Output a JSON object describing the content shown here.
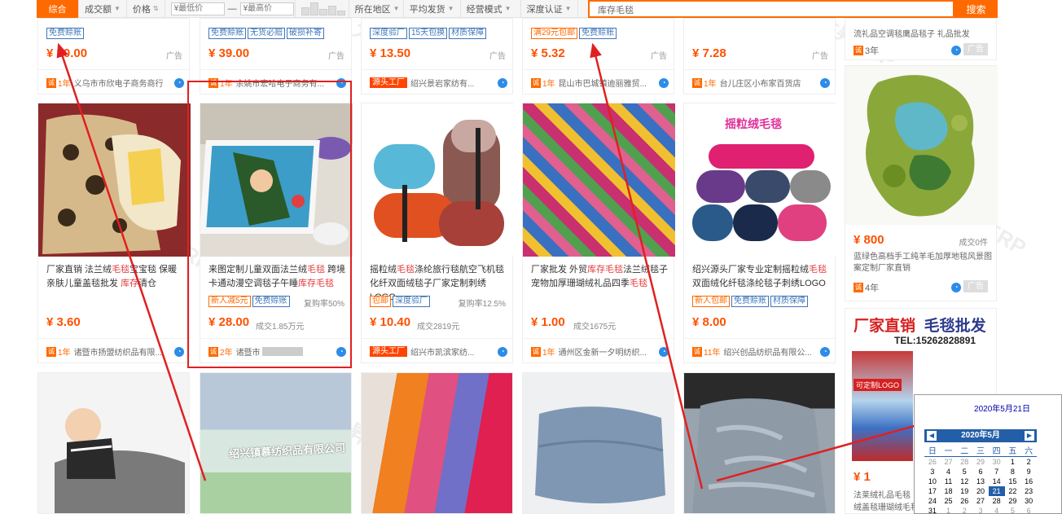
{
  "filterbar": {
    "items": [
      "综合",
      "成交额",
      "价格",
      "所在地区",
      "平均发货",
      "经营模式",
      "深度认证"
    ],
    "min_price_placeholder": "¥最低价",
    "max_price_placeholder": "¥最高价",
    "dash": "—",
    "search_text": "库存毛毯",
    "search_button": "搜索"
  },
  "row0": [
    {
      "tags": [
        "免费赊账"
      ],
      "tag_colors": [
        "b"
      ],
      "price": "¥ 30.00",
      "ad": "广告",
      "years": "1年",
      "seller": "义乌市市欣电子商务商行"
    },
    {
      "tags": [
        "免费赊账",
        "无货必赔",
        "破损补寄"
      ],
      "tag_colors": [
        "b",
        "b",
        "b"
      ],
      "price": "¥ 39.00",
      "ad": "广告",
      "years": "1年",
      "seller": "余姚市宏哈电子商务有..."
    },
    {
      "tags": [
        "深度验厂",
        "15天包换",
        "材质保障"
      ],
      "tag_colors": [
        "b",
        "b",
        "b"
      ],
      "price": "¥ 13.50",
      "ad": "广告",
      "badge": "源头工厂",
      "seller": "绍兴景岩家纺有..."
    },
    {
      "tags": [
        "满29元包邮",
        "免费赊账"
      ],
      "tag_colors": [
        "o",
        "b"
      ],
      "price": "¥ 5.32",
      "ad": "广告",
      "years": "1年",
      "seller": "昆山市巴城镇迪丽雅贸..."
    },
    {
      "tags": [],
      "tag_colors": [],
      "price": "¥ 7.28",
      "ad": "广告",
      "years": "1年",
      "seller": "台儿庄区小布家百货店"
    }
  ],
  "side_top": {
    "title": "流礼品空调毯鹰品毯子 礼品批发",
    "years": "3年",
    "ad": "广告"
  },
  "row1": [
    {
      "title_a": "厂家直销 法兰绒",
      "hl1": "毛毯",
      "title_b": "宝宝毯 保暖亲肤儿童盖毯批发 ",
      "hl2": "库存",
      "title_c": "清仓",
      "tags": [],
      "tag_colors": [],
      "price": "¥ 3.60",
      "deal": "",
      "years": "1年",
      "seller": "诸暨市扬盟纺织品有限..."
    },
    {
      "title_a": "来图定制儿童双面法兰绒",
      "hl1": "毛毯",
      "title_b": " 跨境卡通动漫空调毯子午睡",
      "hl2": "库存毛毯",
      "title_c": "",
      "tags": [
        "新人减5元",
        "免费赊账"
      ],
      "tag_colors": [
        "o",
        "b"
      ],
      "price": "¥ 28.00",
      "deal": "成交1.85万元",
      "repurchase": "复购率50%",
      "years": "2年",
      "seller": "诸暨市"
    },
    {
      "title_a": "摇粒绒",
      "hl1": "毛毯",
      "title_b": "涤纶旅行毯航空飞机毯化纤双面绒毯子厂家定制刺绣LOGO",
      "hl2": "",
      "title_c": "",
      "tags": [
        "包邮",
        "深度验厂"
      ],
      "tag_colors": [
        "o",
        "b"
      ],
      "price": "¥ 10.40",
      "deal": "成交2819元",
      "repurchase": "复购率12.5%",
      "badge": "源头工厂",
      "seller": "绍兴市凯滨家纺..."
    },
    {
      "title_a": "厂家批发 外贸",
      "hl1": "库存毛毯",
      "title_b": "法兰绒毯子宠物加厚珊瑚绒礼品四季",
      "hl2": "毛毯",
      "title_c": "",
      "tags": [],
      "tag_colors": [],
      "price": "¥ 1.00",
      "deal": "成交1675元",
      "years": "1年",
      "seller": "通州区金新一夕明纺织..."
    },
    {
      "title_a": "绍兴源头厂家专业定制摇粒绒",
      "hl1": "毛毯",
      "title_b": "双面绒化纤毯涤纶毯子刺绣LOGO",
      "hl2": "",
      "title_c": "",
      "tags": [
        "新人包邮",
        "免费赊账",
        "材质保障"
      ],
      "tag_colors": [
        "o",
        "b",
        "b"
      ],
      "price": "¥ 8.00",
      "deal": "",
      "years": "11年",
      "seller": "绍兴创品纺织品有限公..."
    }
  ],
  "side_mid": {
    "price": "¥ 800",
    "deal": "成交0件",
    "title": "蓝绿色高档手工纯羊毛加厚地毯风景图案定制厂家直销",
    "years": "4年",
    "ad": "广告",
    "img_text1": "厂家直销",
    "img_text2": "毛毯批发",
    "img_text3": "TEL:15262828891"
  },
  "side_bottom": {
    "price": "¥ 1",
    "title": "法莱绒礼品毛毯",
    "title2": "绒盖毯珊瑚绒毛毯",
    "img_label": "可定制LOGO"
  },
  "row2_images": [
    "baby-blanket",
    "folded-blankets-factory",
    "colorful-fleece-blankets",
    "grey-blue-blanket",
    "grey-plush-blanket"
  ],
  "row2_img_text": "绍兴镇慕纺织品有限公司",
  "watermark": "大昇ERP",
  "calendar": {
    "header": "2020年5月21日",
    "month": "2020年5月",
    "prev": "◀",
    "next": "▶",
    "weekdays": [
      "日",
      "一",
      "二",
      "三",
      "四",
      "五",
      "六"
    ],
    "weeks": [
      [
        [
          "26",
          "g"
        ],
        [
          "27",
          "g"
        ],
        [
          "28",
          "g"
        ],
        [
          "29",
          "g"
        ],
        [
          "30",
          "g"
        ],
        [
          "1",
          ""
        ],
        [
          "2",
          ""
        ]
      ],
      [
        [
          "3",
          ""
        ],
        [
          "4",
          ""
        ],
        [
          "5",
          ""
        ],
        [
          "6",
          ""
        ],
        [
          "7",
          ""
        ],
        [
          "8",
          ""
        ],
        [
          "9",
          ""
        ]
      ],
      [
        [
          "10",
          ""
        ],
        [
          "11",
          ""
        ],
        [
          "12",
          ""
        ],
        [
          "13",
          ""
        ],
        [
          "14",
          ""
        ],
        [
          "15",
          ""
        ],
        [
          "16",
          ""
        ]
      ],
      [
        [
          "17",
          ""
        ],
        [
          "18",
          ""
        ],
        [
          "19",
          ""
        ],
        [
          "20",
          ""
        ],
        [
          "21",
          "sel"
        ],
        [
          "22",
          ""
        ],
        [
          "23",
          ""
        ]
      ],
      [
        [
          "24",
          ""
        ],
        [
          "25",
          ""
        ],
        [
          "26",
          ""
        ],
        [
          "27",
          ""
        ],
        [
          "28",
          ""
        ],
        [
          "29",
          ""
        ],
        [
          "30",
          ""
        ]
      ],
      [
        [
          "31",
          ""
        ],
        [
          "1",
          "g"
        ],
        [
          "2",
          "g"
        ],
        [
          "3",
          "g"
        ],
        [
          "4",
          "g"
        ],
        [
          "5",
          "g"
        ],
        [
          "6",
          "g"
        ]
      ]
    ]
  },
  "colors": {
    "accent": "#ff6a00",
    "price": "#ff5000",
    "highlight": "#e4393c",
    "annotation": "#e02020",
    "calendar": "#235ea8"
  }
}
